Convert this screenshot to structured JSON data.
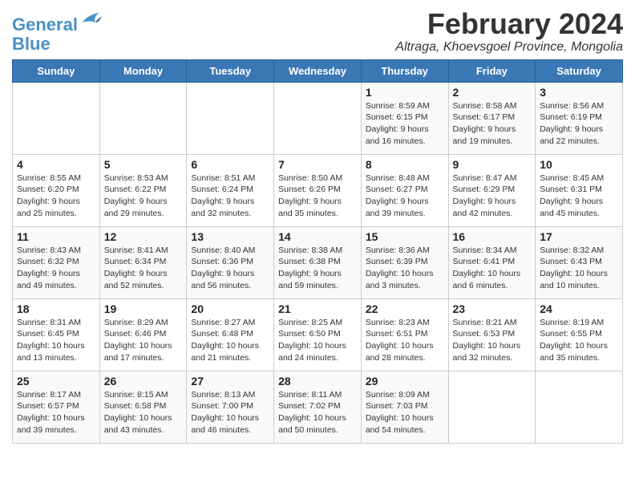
{
  "logo": {
    "line1": "General",
    "line2": "Blue"
  },
  "title": "February 2024",
  "subtitle": "Altraga, Khoevsgoel Province, Mongolia",
  "weekdays": [
    "Sunday",
    "Monday",
    "Tuesday",
    "Wednesday",
    "Thursday",
    "Friday",
    "Saturday"
  ],
  "weeks": [
    [
      {
        "day": "",
        "info": ""
      },
      {
        "day": "",
        "info": ""
      },
      {
        "day": "",
        "info": ""
      },
      {
        "day": "",
        "info": ""
      },
      {
        "day": "1",
        "info": "Sunrise: 8:59 AM\nSunset: 6:15 PM\nDaylight: 9 hours and 16 minutes."
      },
      {
        "day": "2",
        "info": "Sunrise: 8:58 AM\nSunset: 6:17 PM\nDaylight: 9 hours and 19 minutes."
      },
      {
        "day": "3",
        "info": "Sunrise: 8:56 AM\nSunset: 6:19 PM\nDaylight: 9 hours and 22 minutes."
      }
    ],
    [
      {
        "day": "4",
        "info": "Sunrise: 8:55 AM\nSunset: 6:20 PM\nDaylight: 9 hours and 25 minutes."
      },
      {
        "day": "5",
        "info": "Sunrise: 8:53 AM\nSunset: 6:22 PM\nDaylight: 9 hours and 29 minutes."
      },
      {
        "day": "6",
        "info": "Sunrise: 8:51 AM\nSunset: 6:24 PM\nDaylight: 9 hours and 32 minutes."
      },
      {
        "day": "7",
        "info": "Sunrise: 8:50 AM\nSunset: 6:26 PM\nDaylight: 9 hours and 35 minutes."
      },
      {
        "day": "8",
        "info": "Sunrise: 8:48 AM\nSunset: 6:27 PM\nDaylight: 9 hours and 39 minutes."
      },
      {
        "day": "9",
        "info": "Sunrise: 8:47 AM\nSunset: 6:29 PM\nDaylight: 9 hours and 42 minutes."
      },
      {
        "day": "10",
        "info": "Sunrise: 8:45 AM\nSunset: 6:31 PM\nDaylight: 9 hours and 45 minutes."
      }
    ],
    [
      {
        "day": "11",
        "info": "Sunrise: 8:43 AM\nSunset: 6:32 PM\nDaylight: 9 hours and 49 minutes."
      },
      {
        "day": "12",
        "info": "Sunrise: 8:41 AM\nSunset: 6:34 PM\nDaylight: 9 hours and 52 minutes."
      },
      {
        "day": "13",
        "info": "Sunrise: 8:40 AM\nSunset: 6:36 PM\nDaylight: 9 hours and 56 minutes."
      },
      {
        "day": "14",
        "info": "Sunrise: 8:38 AM\nSunset: 6:38 PM\nDaylight: 9 hours and 59 minutes."
      },
      {
        "day": "15",
        "info": "Sunrise: 8:36 AM\nSunset: 6:39 PM\nDaylight: 10 hours and 3 minutes."
      },
      {
        "day": "16",
        "info": "Sunrise: 8:34 AM\nSunset: 6:41 PM\nDaylight: 10 hours and 6 minutes."
      },
      {
        "day": "17",
        "info": "Sunrise: 8:32 AM\nSunset: 6:43 PM\nDaylight: 10 hours and 10 minutes."
      }
    ],
    [
      {
        "day": "18",
        "info": "Sunrise: 8:31 AM\nSunset: 6:45 PM\nDaylight: 10 hours and 13 minutes."
      },
      {
        "day": "19",
        "info": "Sunrise: 8:29 AM\nSunset: 6:46 PM\nDaylight: 10 hours and 17 minutes."
      },
      {
        "day": "20",
        "info": "Sunrise: 8:27 AM\nSunset: 6:48 PM\nDaylight: 10 hours and 21 minutes."
      },
      {
        "day": "21",
        "info": "Sunrise: 8:25 AM\nSunset: 6:50 PM\nDaylight: 10 hours and 24 minutes."
      },
      {
        "day": "22",
        "info": "Sunrise: 8:23 AM\nSunset: 6:51 PM\nDaylight: 10 hours and 28 minutes."
      },
      {
        "day": "23",
        "info": "Sunrise: 8:21 AM\nSunset: 6:53 PM\nDaylight: 10 hours and 32 minutes."
      },
      {
        "day": "24",
        "info": "Sunrise: 8:19 AM\nSunset: 6:55 PM\nDaylight: 10 hours and 35 minutes."
      }
    ],
    [
      {
        "day": "25",
        "info": "Sunrise: 8:17 AM\nSunset: 6:57 PM\nDaylight: 10 hours and 39 minutes."
      },
      {
        "day": "26",
        "info": "Sunrise: 8:15 AM\nSunset: 6:58 PM\nDaylight: 10 hours and 43 minutes."
      },
      {
        "day": "27",
        "info": "Sunrise: 8:13 AM\nSunset: 7:00 PM\nDaylight: 10 hours and 46 minutes."
      },
      {
        "day": "28",
        "info": "Sunrise: 8:11 AM\nSunset: 7:02 PM\nDaylight: 10 hours and 50 minutes."
      },
      {
        "day": "29",
        "info": "Sunrise: 8:09 AM\nSunset: 7:03 PM\nDaylight: 10 hours and 54 minutes."
      },
      {
        "day": "",
        "info": ""
      },
      {
        "day": "",
        "info": ""
      }
    ]
  ]
}
